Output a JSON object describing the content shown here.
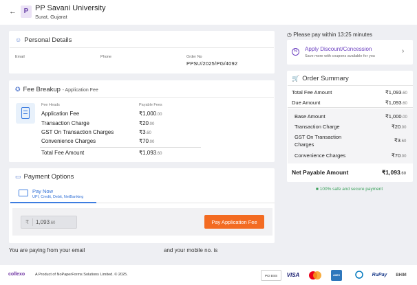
{
  "header": {
    "back_icon": "arrow-left-icon",
    "logo_letter": "P",
    "university": "PP Savani University",
    "location": "Surat, Gujarat"
  },
  "personal": {
    "title": "Personal Details",
    "email_label": "Email",
    "phone_label": "Phone",
    "order_label": "Order No",
    "order_value": "PPSU/2025/PG/4092"
  },
  "fee": {
    "title": "Fee Breakup",
    "subtitle": "- Application Fee",
    "col_heads": "Fee Heads",
    "col_payable": "Payable Fees",
    "rows": [
      {
        "label": "Application Fee",
        "amount": "₹1,000",
        "paise": ".00"
      },
      {
        "label": "Transaction Charge",
        "amount": "₹20",
        "paise": ".00"
      },
      {
        "label": "GST On Transaction Charges",
        "amount": "₹3",
        "paise": ".60"
      },
      {
        "label": "Convenience Charges",
        "amount": "₹70",
        "paise": ".00"
      }
    ],
    "total_label": "Total Fee Amount",
    "total_amount": "₹1,093",
    "total_paise": ".60"
  },
  "payment": {
    "title": "Payment Options",
    "tab_title": "Pay Now",
    "tab_sub": "UPI, Credit, Debit, NetBanking",
    "currency": "₹",
    "amount": "1,093",
    "amount_paise": ".60",
    "button": "Pay Application Fee"
  },
  "info": {
    "email_text": "You are paying from your email",
    "mobile_text": "and your mobile no. is"
  },
  "right": {
    "timer": "Please pay within 13:25 minutes",
    "discount_title": "Apply Discount/Concession",
    "discount_sub": "Save more with coupons available for you",
    "summary_title": "Order Summary",
    "total_fee_label": "Total Fee Amount",
    "total_fee_amount": "₹1,093",
    "total_fee_paise": ".60",
    "due_label": "Due Amount",
    "due_amount": "₹1,093",
    "due_paise": ".60",
    "lines": [
      {
        "label": "Base Amount",
        "amount": "₹1,000",
        "paise": ".00"
      },
      {
        "label": "Transaction Charge",
        "amount": "₹20",
        "paise": ".00"
      },
      {
        "label": "GST On Transaction",
        "label2": "Charges",
        "amount": "₹3",
        "paise": ".60"
      },
      {
        "label": "Convenience Charges",
        "amount": "₹70",
        "paise": ".00"
      }
    ],
    "net_label": "Net Payable Amount",
    "net_amount": "₹1,093",
    "net_paise": ".60",
    "safe_text": "100% safe and secure payment"
  },
  "footer": {
    "brand": "collexo",
    "text": "A Product of NoPaperForms Solutions Limited. © 2025.",
    "logos": [
      "PCI DSS",
      "VISA",
      "MC",
      "AMEX",
      "DINERS",
      "RuPay",
      "BHIM"
    ]
  }
}
